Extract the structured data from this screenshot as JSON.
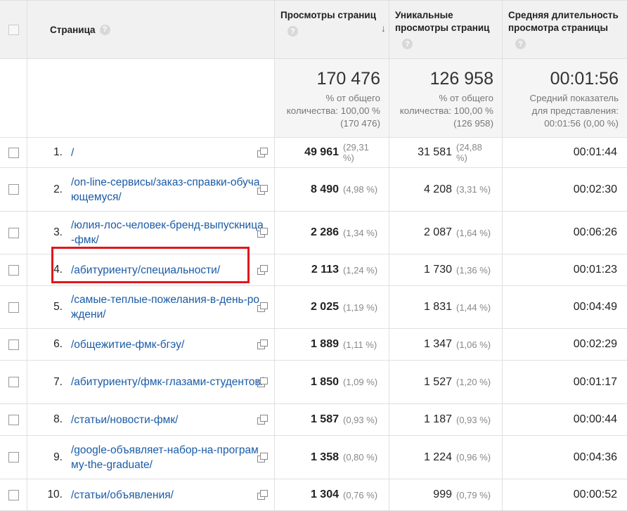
{
  "header": {
    "page_label": "Страница",
    "pageviews_label": "Просмотры страниц",
    "unique_label_1": "Уникальные",
    "unique_label_2": "просмотры страниц",
    "duration_label_1": "Средняя длительность",
    "duration_label_2": "просмотра страницы",
    "help_glyph": "?",
    "sort_glyph": "↓"
  },
  "totals": {
    "pageviews": "170 476",
    "pageviews_sub1": "% от общего",
    "pageviews_sub2": "количества: 100,00 %",
    "pageviews_sub3": "(170 476)",
    "unique": "126 958",
    "unique_sub1": "% от общего",
    "unique_sub2": "количества: 100,00 %",
    "unique_sub3": "(126 958)",
    "duration": "00:01:56",
    "duration_sub1": "Средний показатель",
    "duration_sub2": "для представления:",
    "duration_sub3": "00:01:56 (0,00 %)"
  },
  "rows": [
    {
      "num": "1.",
      "page": "/",
      "pv": "49 961",
      "pv_pct": "(29,31 %)",
      "uv": "31 581",
      "uv_pct": "(24,88 %)",
      "dur": "00:01:44"
    },
    {
      "num": "2.",
      "page": "/on-line-сервисы/заказ-справки-обучающемуся/",
      "pv": "8 490",
      "pv_pct": "(4,98 %)",
      "uv": "4 208",
      "uv_pct": "(3,31 %)",
      "dur": "00:02:30"
    },
    {
      "num": "3.",
      "page": "/юлия-лос-человек-бренд-выпускница-фмк/",
      "pv": "2 286",
      "pv_pct": "(1,34 %)",
      "uv": "2 087",
      "uv_pct": "(1,64 %)",
      "dur": "00:06:26"
    },
    {
      "num": "4.",
      "page": "/абитуриенту/специальности/",
      "pv": "2 113",
      "pv_pct": "(1,24 %)",
      "uv": "1 730",
      "uv_pct": "(1,36 %)",
      "dur": "00:01:23"
    },
    {
      "num": "5.",
      "page": "/самые-теплые-пожелания-в-день-рождени/",
      "pv": "2 025",
      "pv_pct": "(1,19 %)",
      "uv": "1 831",
      "uv_pct": "(1,44 %)",
      "dur": "00:04:49"
    },
    {
      "num": "6.",
      "page": "/общежитие-фмк-бгэу/",
      "pv": "1 889",
      "pv_pct": "(1,11 %)",
      "uv": "1 347",
      "uv_pct": "(1,06 %)",
      "dur": "00:02:29"
    },
    {
      "num": "7.",
      "page": "/абитуриенту/фмк-глазами-студентов/",
      "pv": "1 850",
      "pv_pct": "(1,09 %)",
      "uv": "1 527",
      "uv_pct": "(1,20 %)",
      "dur": "00:01:17"
    },
    {
      "num": "8.",
      "page": "/статьи/новости-фмк/",
      "pv": "1 587",
      "pv_pct": "(0,93 %)",
      "uv": "1 187",
      "uv_pct": "(0,93 %)",
      "dur": "00:00:44"
    },
    {
      "num": "9.",
      "page": "/google-объявляет-набор-на-программу-the-graduate/",
      "pv": "1 358",
      "pv_pct": "(0,80 %)",
      "uv": "1 224",
      "uv_pct": "(0,96 %)",
      "dur": "00:04:36"
    },
    {
      "num": "10.",
      "page": "/статьи/объявления/",
      "pv": "1 304",
      "pv_pct": "(0,76 %)",
      "uv": "999",
      "uv_pct": "(0,79 %)",
      "dur": "00:00:52"
    }
  ],
  "colors": {
    "link": "#1a5ba6",
    "highlight": "#e0161c",
    "header_bg": "#f1f1f1"
  }
}
